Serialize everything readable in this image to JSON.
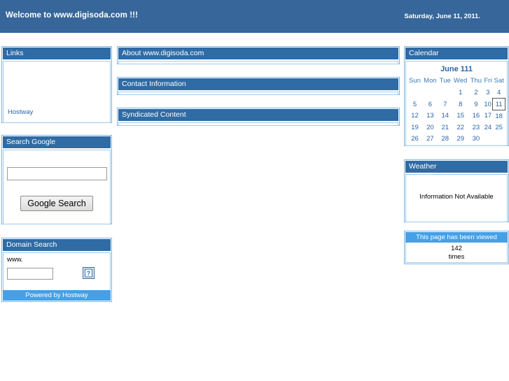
{
  "banner": {
    "title": "Welcome to www.digisoda.com !!!",
    "date": "Saturday, June 11, 2011."
  },
  "left": {
    "links_panel": {
      "title": "Links",
      "items": [
        {
          "label": "Hostway"
        }
      ]
    },
    "search_google_panel": {
      "title": "Search Google",
      "query_value": "",
      "query_placeholder": "",
      "button_label": "Google Search"
    },
    "domain_search_panel": {
      "title": "Domain Search",
      "prefix_label": "www.",
      "domain_value": "",
      "domain_placeholder": "",
      "submit_icon": "broken-image-icon",
      "footer_label": "Powered by Hostway"
    }
  },
  "center": {
    "panels": [
      {
        "title": "About www.digisoda.com"
      },
      {
        "title": "Contact Information"
      },
      {
        "title": "Syndicated Content"
      }
    ]
  },
  "right": {
    "calendar_panel": {
      "title": "Calendar",
      "month_title": "June 111",
      "weekdays": [
        "Sun",
        "Mon",
        "Tue",
        "Wed",
        "Thu",
        "Fri",
        "Sat"
      ],
      "weeks": [
        [
          "",
          "",
          "",
          "1",
          "2",
          "3",
          "4"
        ],
        [
          "5",
          "6",
          "7",
          "8",
          "9",
          "10",
          "11"
        ],
        [
          "12",
          "13",
          "14",
          "15",
          "16",
          "17",
          "18"
        ],
        [
          "19",
          "20",
          "21",
          "22",
          "23",
          "24",
          "25"
        ],
        [
          "26",
          "27",
          "28",
          "29",
          "30",
          "",
          ""
        ]
      ],
      "today": "11"
    },
    "weather_panel": {
      "title": "Weather",
      "message": "Information Not Available"
    },
    "counter_panel": {
      "title": "This page has been viewed",
      "count": "142",
      "unit": "times"
    }
  },
  "colors": {
    "banner_bg": "#36669a",
    "panel_header_bg": "#2f6ba4",
    "panel_border": "#7fb5e0",
    "accent_light": "#45a0e8",
    "link": "#2a64a8"
  }
}
